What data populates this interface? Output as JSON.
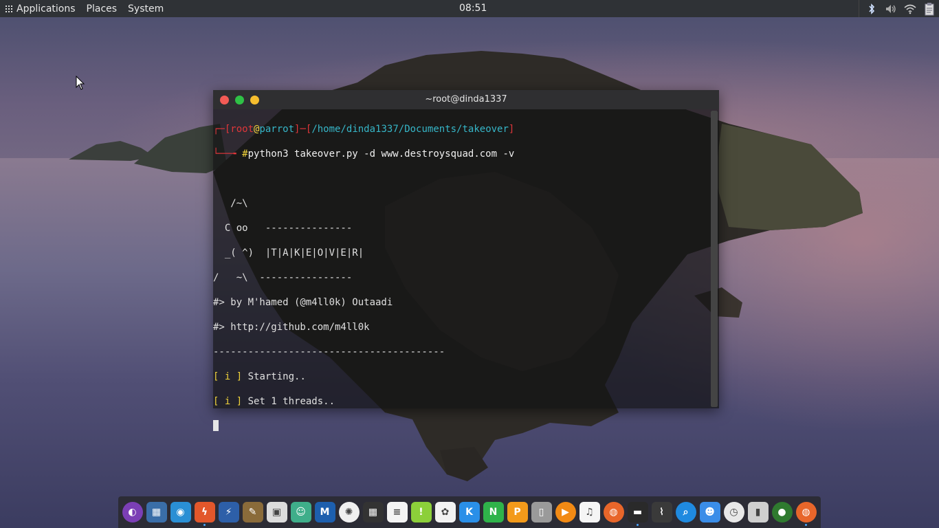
{
  "panel": {
    "menu": [
      "Applications",
      "Places",
      "System"
    ],
    "clock": "08:51",
    "tray": [
      "bluetooth-icon",
      "volume-icon",
      "wifi-icon",
      "clipboard-icon"
    ]
  },
  "terminal": {
    "title": "~root@dinda1337",
    "prompt": {
      "user": "root",
      "at": "@",
      "host": "parrot",
      "path": "/home/dinda1337/Documents/takeover",
      "symbol": "#",
      "command": "python3 takeover.py -d www.destroysquad.com -v"
    },
    "banner": [
      "",
      "   /~\\",
      "  C oo   ---------------",
      "  _( ^)  |T|A|K|E|O|V|E|R|",
      "/   ~\\  ----------------",
      "#> by M'hamed (@m4ll0k) Outaadi",
      "#> http://github.com/m4ll0k",
      "----------------------------------------"
    ],
    "status": [
      {
        "tag": "[ i ]",
        "text": " Starting.."
      },
      {
        "tag": "[ i ]",
        "text": " Set 1 threads.."
      }
    ]
  },
  "dock": [
    {
      "name": "launcher-icon",
      "bg": "#7b3fb5",
      "glyph": "◐"
    },
    {
      "name": "image-viewer-icon",
      "bg": "#3a6ea8",
      "glyph": "▦"
    },
    {
      "name": "eye-icon",
      "bg": "#2a8fd4",
      "glyph": "◉"
    },
    {
      "name": "burpsuite-icon",
      "bg": "#e2572b",
      "glyph": "ϟ"
    },
    {
      "name": "zap-icon",
      "bg": "#2d5fa8",
      "glyph": "⚡"
    },
    {
      "name": "gimp-icon",
      "bg": "#8a6b3a",
      "glyph": "✎"
    },
    {
      "name": "screenshot-icon",
      "bg": "#dcdcdc",
      "glyph": "▣"
    },
    {
      "name": "avatar-app-icon",
      "bg": "#3fae8a",
      "glyph": "☺"
    },
    {
      "name": "metasploit-icon",
      "bg": "#1d5fae",
      "glyph": "M"
    },
    {
      "name": "coral-icon",
      "bg": "#f0f0f0",
      "glyph": "✺"
    },
    {
      "name": "calculator-icon",
      "bg": "#333333",
      "glyph": "▦"
    },
    {
      "name": "text-editor-icon",
      "bg": "#f4f4f4",
      "glyph": "≡"
    },
    {
      "name": "notes-icon",
      "bg": "#8ccf3a",
      "glyph": "!"
    },
    {
      "name": "photos-icon",
      "bg": "#f2f2f2",
      "glyph": "✿"
    },
    {
      "name": "keynote-icon",
      "bg": "#2a8fe8",
      "glyph": "K"
    },
    {
      "name": "numbers-icon",
      "bg": "#2fb34a",
      "glyph": "N"
    },
    {
      "name": "pages-icon",
      "bg": "#f39a1a",
      "glyph": "P"
    },
    {
      "name": "archive-icon",
      "bg": "#9a9a9a",
      "glyph": "▯"
    },
    {
      "name": "media-player-icon",
      "bg": "#f28a14",
      "glyph": "▶"
    },
    {
      "name": "music-icon",
      "bg": "#f5f5f5",
      "glyph": "♫"
    },
    {
      "name": "firefox-icon",
      "bg": "#e8662a",
      "glyph": "◍"
    },
    {
      "name": "terminal-icon",
      "bg": "#2a2a2a",
      "glyph": "▬"
    },
    {
      "name": "paperclip-icon",
      "bg": "#3a3a3a",
      "glyph": "⌇"
    },
    {
      "name": "search-icon",
      "bg": "#1f8ae0",
      "glyph": "⌕"
    },
    {
      "name": "finder-icon",
      "bg": "#3a8de8",
      "glyph": "☻"
    },
    {
      "name": "clock-icon",
      "bg": "#e8e8e8",
      "glyph": "◷"
    },
    {
      "name": "trash-icon",
      "bg": "#cfcfcf",
      "glyph": "▮"
    },
    {
      "name": "green-orb-icon",
      "bg": "#2f7a2f",
      "glyph": "●"
    },
    {
      "name": "firefox-alt-icon",
      "bg": "#e8662a",
      "glyph": "◍"
    }
  ]
}
